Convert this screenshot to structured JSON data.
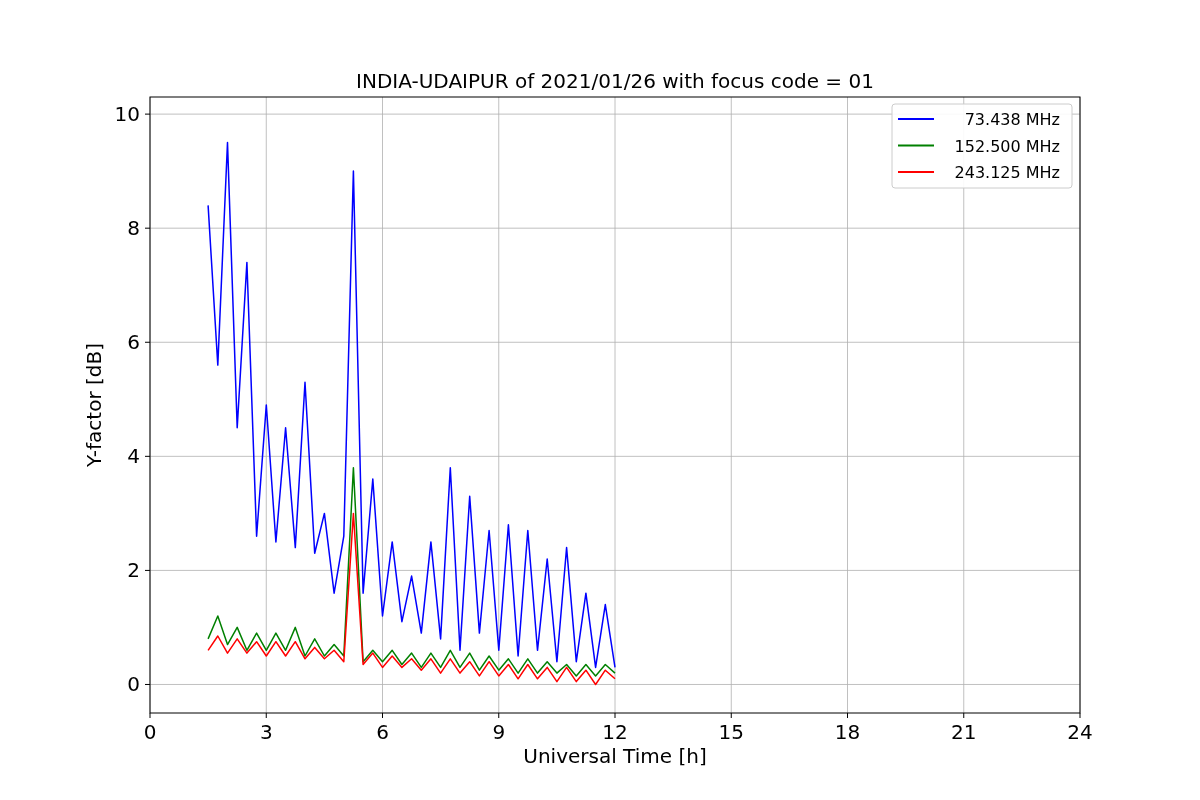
{
  "chart_data": {
    "type": "line",
    "title": "INDIA-UDAIPUR of 2021/01/26 with focus code = 01",
    "xlabel": "Universal Time [h]",
    "ylabel": "Y-factor [dB]",
    "x": [
      1.5,
      1.75,
      2.0,
      2.25,
      2.5,
      2.75,
      3.0,
      3.25,
      3.5,
      3.75,
      4.0,
      4.25,
      4.5,
      4.75,
      5.0,
      5.25,
      5.5,
      5.75,
      6.0,
      6.25,
      6.5,
      6.75,
      7.0,
      7.25,
      7.5,
      7.75,
      8.0,
      8.25,
      8.5,
      8.75,
      9.0,
      9.25,
      9.5,
      9.75,
      10.0,
      10.25,
      10.5,
      10.75,
      11.0,
      11.25,
      11.5,
      11.75,
      12.0
    ],
    "series": [
      {
        "name": "73.438 MHz",
        "color": "#0000ff",
        "values": [
          8.4,
          5.6,
          9.5,
          4.5,
          7.4,
          2.6,
          4.9,
          2.5,
          4.5,
          2.4,
          5.3,
          2.3,
          3.0,
          1.6,
          2.6,
          9.0,
          1.6,
          3.6,
          1.2,
          2.5,
          1.1,
          1.9,
          0.9,
          2.5,
          0.8,
          3.8,
          0.6,
          3.3,
          0.9,
          2.7,
          0.6,
          2.8,
          0.5,
          2.7,
          0.6,
          2.2,
          0.4,
          2.4,
          0.4,
          1.6,
          0.3,
          1.4,
          0.3
        ]
      },
      {
        "name": "152.500 MHz",
        "color": "#008000",
        "values": [
          0.8,
          1.2,
          0.7,
          1.0,
          0.6,
          0.9,
          0.6,
          0.9,
          0.6,
          1.0,
          0.5,
          0.8,
          0.5,
          0.7,
          0.5,
          3.8,
          0.4,
          0.6,
          0.4,
          0.6,
          0.35,
          0.55,
          0.3,
          0.55,
          0.3,
          0.6,
          0.3,
          0.55,
          0.25,
          0.5,
          0.25,
          0.45,
          0.2,
          0.45,
          0.2,
          0.4,
          0.2,
          0.35,
          0.15,
          0.35,
          0.15,
          0.35,
          0.2
        ]
      },
      {
        "name": "243.125 MHz",
        "color": "#ff0000",
        "values": [
          0.6,
          0.85,
          0.55,
          0.8,
          0.55,
          0.75,
          0.5,
          0.75,
          0.5,
          0.75,
          0.45,
          0.65,
          0.45,
          0.6,
          0.4,
          3.0,
          0.35,
          0.55,
          0.3,
          0.5,
          0.3,
          0.45,
          0.25,
          0.45,
          0.2,
          0.45,
          0.2,
          0.4,
          0.15,
          0.4,
          0.15,
          0.35,
          0.1,
          0.35,
          0.1,
          0.3,
          0.05,
          0.3,
          0.05,
          0.25,
          0.0,
          0.25,
          0.1
        ]
      }
    ],
    "grid": true,
    "legend": true,
    "xlim": [
      0,
      24
    ],
    "ylim": [
      -0.5,
      10.3
    ],
    "xticks": [
      0,
      3,
      6,
      9,
      12,
      15,
      18,
      21,
      24
    ],
    "yticks": [
      0,
      2,
      4,
      6,
      8,
      10
    ]
  }
}
